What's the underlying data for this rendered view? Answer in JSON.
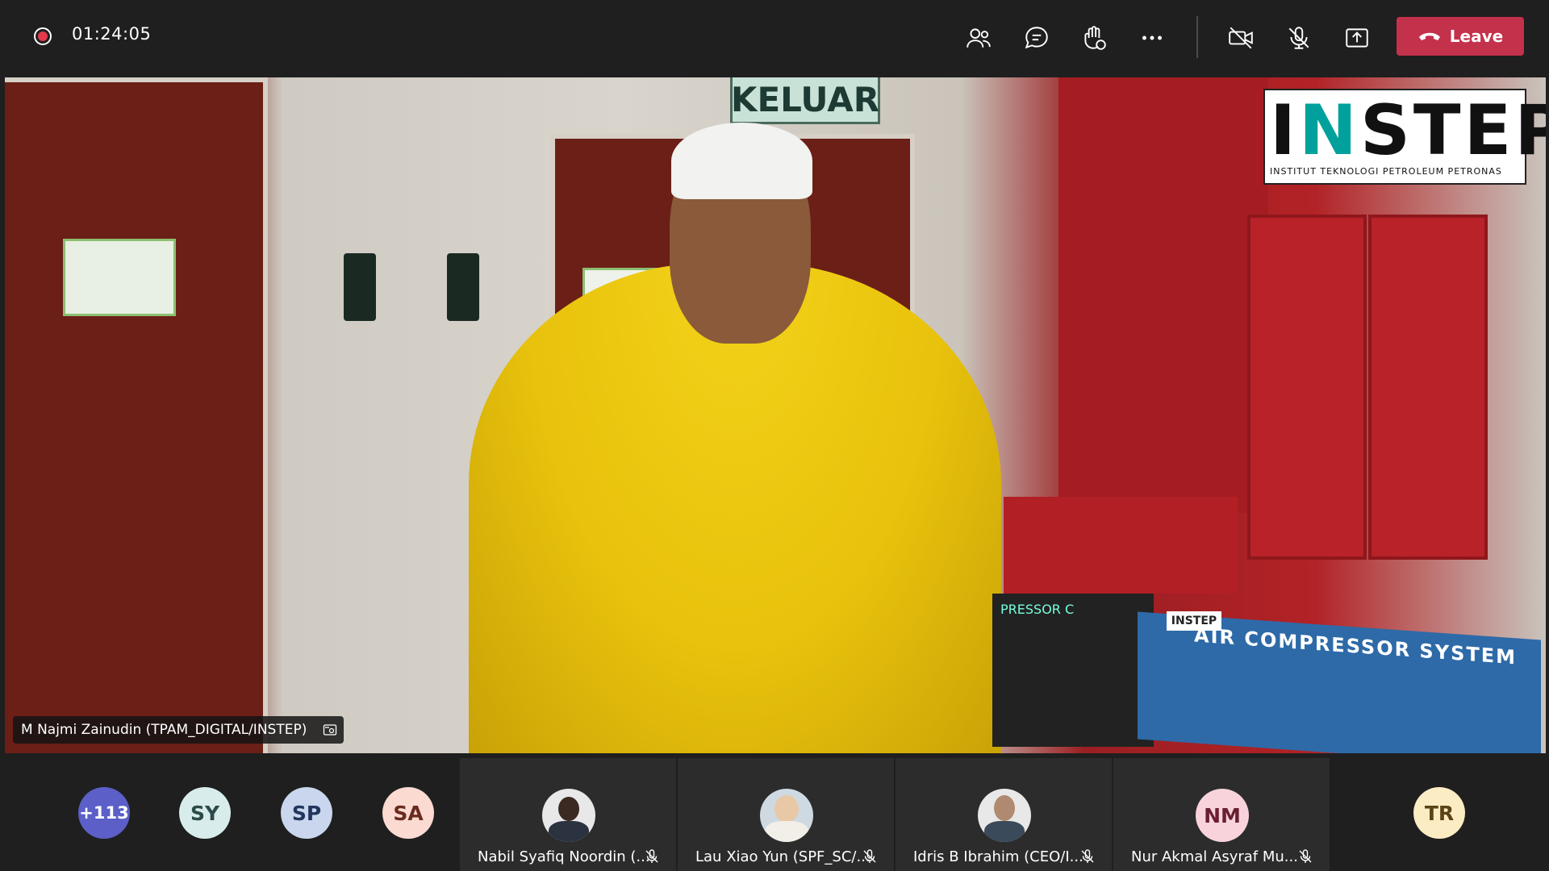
{
  "meeting": {
    "timer": "01:24:05",
    "leave_label": "Leave"
  },
  "toolbar": {
    "icons": [
      "people-icon",
      "chat-icon",
      "raise-hand-icon",
      "more-icon",
      "camera-off-icon",
      "mic-off-icon",
      "share-icon",
      "phone-icon"
    ]
  },
  "video": {
    "speaker_name": "M Najmi Zainudin (TPAM_DIGITAL/INSTEP)",
    "sign_text": "KELUAR",
    "logo_text_a": "I",
    "logo_text_b": "N",
    "logo_text_c": "STEP",
    "logo_subtitle": "INSTITUT TEKNOLOGI PETROLEUM PETRONAS",
    "panel_title": "AIR COMPRESSOR SYSTEM",
    "panel_badge": "INSTEP",
    "panel_left_title": "PRESSOR C"
  },
  "participants": {
    "overflow": "+113",
    "avatars": [
      {
        "initials": "SY",
        "bg": "#d8ecec",
        "fg": "#2c4a4a"
      },
      {
        "initials": "SP",
        "bg": "#c9d6ee",
        "fg": "#22355c"
      },
      {
        "initials": "SA",
        "bg": "#fbdad2",
        "fg": "#6a2a1e"
      }
    ],
    "tiles": [
      {
        "name": "Nabil Syafiq Noordin (..."
      },
      {
        "name": "Lau Xiao Yun (SPF_SC/..."
      },
      {
        "name": "Idris B Ibrahim (CEO/I..."
      },
      {
        "name": "Nur Akmal Asyraf Mu...",
        "initials": "NM"
      }
    ],
    "last_avatar": {
      "initials": "TR",
      "bg": "#fbecc4",
      "fg": "#5a4416"
    }
  },
  "colors": {
    "accent": "#c4314b",
    "overflow_bg": "#5b5fc7"
  }
}
